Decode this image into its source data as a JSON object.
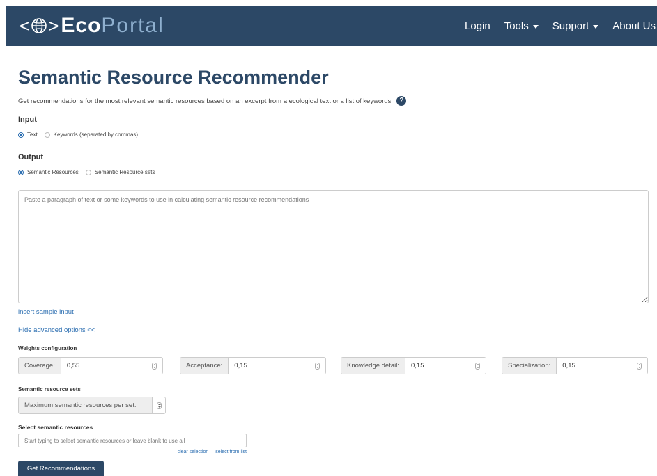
{
  "navbar": {
    "brand_eco": "Eco",
    "brand_portal": "Portal",
    "items": [
      {
        "label": "Login",
        "has_caret": false
      },
      {
        "label": "Tools",
        "has_caret": true
      },
      {
        "label": "Support",
        "has_caret": true
      },
      {
        "label": "About Us",
        "has_caret": false
      }
    ],
    "bg_color": "#2c4866"
  },
  "page": {
    "title": "Semantic Resource Recommender",
    "subtitle": "Get recommendations for the most relevant semantic resources based on an excerpt from a ecological text or a list of keywords",
    "help_icon": "question-circle-icon"
  },
  "input_section": {
    "label": "Input",
    "options": [
      {
        "label": "Text",
        "checked": true
      },
      {
        "label": "Keywords (separated by commas)",
        "checked": false
      }
    ]
  },
  "output_section": {
    "label": "Output",
    "options": [
      {
        "label": "Semantic Resources",
        "checked": true
      },
      {
        "label": "Semantic Resource sets",
        "checked": false
      }
    ]
  },
  "textarea": {
    "placeholder": "Paste a paragraph of text or some keywords to use in calculating semantic resource recommendations",
    "value": ""
  },
  "links": {
    "insert_sample": "insert sample input",
    "hide_advanced": "Hide advanced options <<"
  },
  "weights": {
    "label": "Weights configuration",
    "fields": [
      {
        "label": "Coverage:",
        "value": "0,55"
      },
      {
        "label": "Acceptance:",
        "value": "0,15"
      },
      {
        "label": "Knowledge detail:",
        "value": "0,15"
      },
      {
        "label": "Specialization:",
        "value": "0,15"
      }
    ]
  },
  "sets": {
    "label": "Semantic resource sets",
    "max_label": "Maximum semantic resources per set:",
    "max_value": ""
  },
  "select_resources": {
    "label": "Select semantic resources",
    "placeholder": "Start typing to select semantic resources or leave blank to use all",
    "clear_selection": "clear selection",
    "select_from_list": "select from list"
  },
  "submit": {
    "label": "Get Recommendations"
  }
}
